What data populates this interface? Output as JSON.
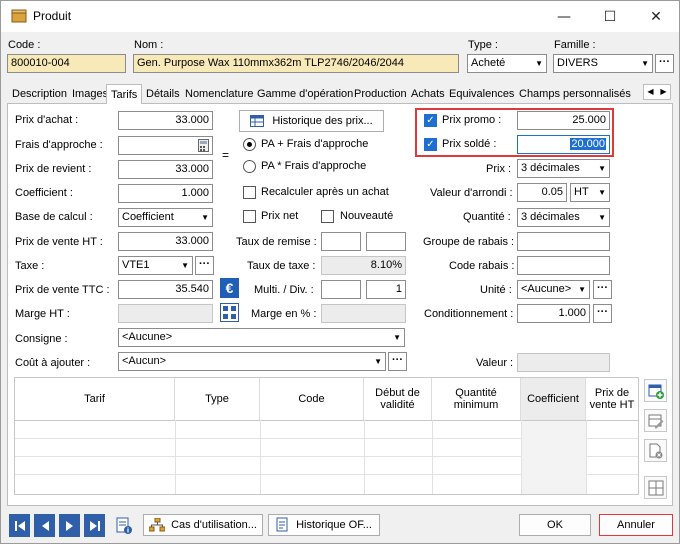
{
  "window": {
    "title": "Produit",
    "minimize": "—",
    "maximize": "☐",
    "close": "✕"
  },
  "header": {
    "code_label": "Code :",
    "code_value": "800010-004",
    "nom_label": "Nom :",
    "nom_value": "Gen. Purpose Wax 110mmx362m TLP2746/2046/2044",
    "type_label": "Type :",
    "type_value": "Acheté",
    "famille_label": "Famille :",
    "famille_value": "DIVERS"
  },
  "tabs": [
    "Description",
    "Images",
    "Tarifs",
    "Détails",
    "Nomenclature",
    "Gamme d'opération",
    "Production",
    "Achats",
    "Equivalences",
    "Champs personnalisés"
  ],
  "left": {
    "prix_achat_label": "Prix d'achat :",
    "prix_achat": "33.000",
    "frais_label": "Frais d'approche :",
    "prix_revient_label": "Prix de revient :",
    "prix_revient": "33.000",
    "coef_label": "Coefficient :",
    "coef": "1.000",
    "base_label": "Base de calcul :",
    "base": "Coefficient",
    "pv_ht_label": "Prix de vente HT :",
    "pv_ht": "33.000",
    "taxe_label": "Taxe :",
    "taxe": "VTE1",
    "pv_ttc_label": "Prix de vente TTC :",
    "pv_ttc": "35.540",
    "marge_ht_label": "Marge HT :",
    "consigne_label": "Consigne :",
    "consigne": "<Aucune>",
    "cout_label": "Coût à ajouter :",
    "cout": "<Aucun>"
  },
  "middle": {
    "historique_btn": "Historique des prix...",
    "equals": "=",
    "radio1": "PA + Frais d'approche",
    "radio2": "PA * Frais d'approche",
    "recalc": "Recalculer après un achat",
    "prix_net": "Prix net",
    "nouveaute": "Nouveauté",
    "remise_label": "Taux de remise :",
    "taxe_taux_label": "Taux de taxe :",
    "taxe_taux": "8.10%",
    "multi_label": "Multi. / Div. :",
    "multi_div": "1",
    "marge_pct_label": "Marge en % :"
  },
  "right": {
    "promo_label": "Prix promo :",
    "promo_value": "25.000",
    "solde_label": "Prix soldé :",
    "solde_value": "20.000",
    "prix_label": "Prix :",
    "prix_value": "3 décimales",
    "arrondi_label": "Valeur d'arrondi :",
    "arrondi_value": "0.05",
    "arrondi_unit": "HT",
    "quantite_label": "Quantité :",
    "quantite_value": "3 décimales",
    "groupe_label": "Groupe de rabais :",
    "code_rabais_label": "Code rabais :",
    "unite_label": "Unité :",
    "unite_value": "<Aucune>",
    "conditionnement_label": "Conditionnement :",
    "conditionnement_value": "1.000",
    "valeur_label": "Valeur :"
  },
  "grid": {
    "columns": [
      "Tarif",
      "Type",
      "Code",
      "Début de validité",
      "Quantité minimum",
      "Coefficient",
      "Prix de vente HT"
    ]
  },
  "footer": {
    "cas_btn": "Cas d'utilisation...",
    "historique_of_btn": "Historique OF...",
    "ok": "OK",
    "annuler": "Annuler"
  },
  "colors": {
    "highlight": "#e0393b",
    "accent": "#1e6fd0",
    "readonly": "#f7e9b8",
    "nav": "#2f5fa8"
  }
}
